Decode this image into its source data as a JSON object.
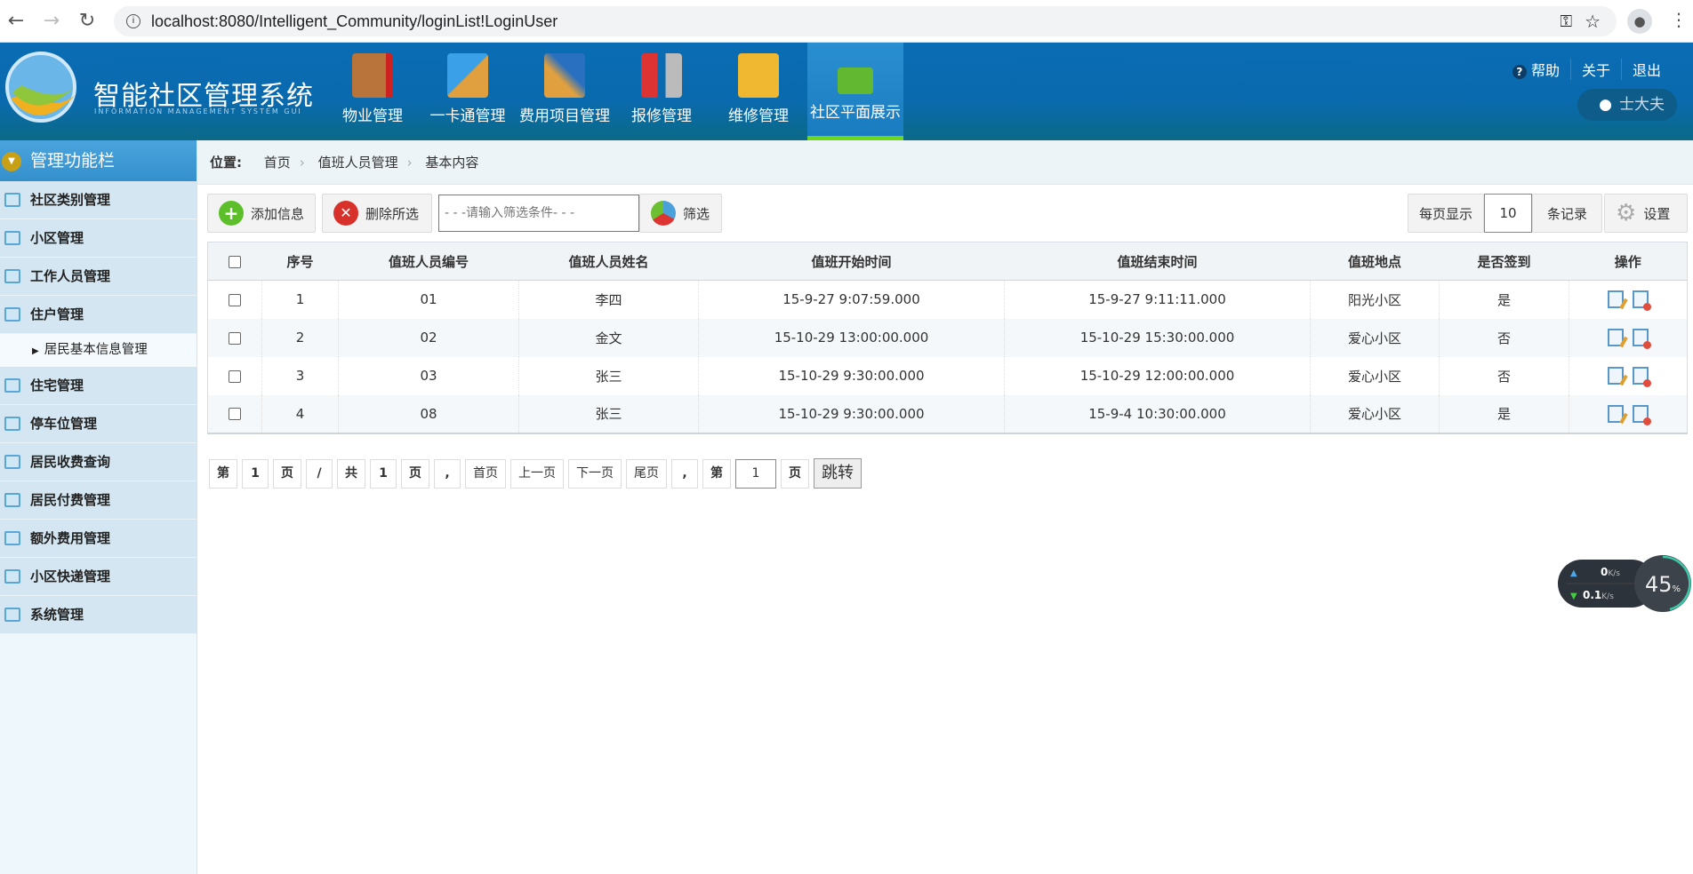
{
  "browser": {
    "url": "localhost:8080/Intelligent_Community/loginList!LoginUser"
  },
  "header": {
    "title": "智能社区管理系统",
    "subtitle": "INFORMATION MANAGEMENT SYSTEM GUI",
    "nav": [
      {
        "label": "物业管理"
      },
      {
        "label": "一卡通管理"
      },
      {
        "label": "费用项目管理"
      },
      {
        "label": "报修管理"
      },
      {
        "label": "维修管理"
      },
      {
        "label": "社区平面展示"
      }
    ],
    "links": {
      "help": "帮助",
      "about": "关于",
      "logout": "退出"
    },
    "user": "士大夫"
  },
  "sidebar": {
    "title": "管理功能栏",
    "items": [
      {
        "label": "社区类别管理"
      },
      {
        "label": "小区管理"
      },
      {
        "label": "工作人员管理"
      },
      {
        "label": "住户管理"
      }
    ],
    "sub": "居民基本信息管理",
    "items2": [
      {
        "label": "住宅管理"
      },
      {
        "label": "停车位管理"
      },
      {
        "label": "居民收费查询"
      },
      {
        "label": "居民付费管理"
      },
      {
        "label": "额外费用管理"
      },
      {
        "label": "小区快递管理"
      },
      {
        "label": "系统管理"
      }
    ]
  },
  "breadcrumb": {
    "label": "位置:",
    "items": [
      "首页",
      "值班人员管理",
      "基本内容"
    ]
  },
  "toolbar": {
    "add": "添加信息",
    "delete": "删除所选",
    "filter_placeholder": "- - -请输入筛选条件- - -",
    "filter": "筛选",
    "per_page_label": "每页显示",
    "per_page": "10",
    "records": "条记录",
    "settings": "设置"
  },
  "table": {
    "headers": [
      "序号",
      "值班人员编号",
      "值班人员姓名",
      "值班开始时间",
      "值班结束时间",
      "值班地点",
      "是否签到",
      "操作"
    ],
    "rows": [
      [
        "1",
        "01",
        "李四",
        "15-9-27 9:07:59.000",
        "15-9-27 9:11:11.000",
        "阳光小区",
        "是"
      ],
      [
        "2",
        "02",
        "金文",
        "15-10-29 13:00:00.000",
        "15-10-29 15:30:00.000",
        "爱心小区",
        "否"
      ],
      [
        "3",
        "03",
        "张三",
        "15-10-29 9:30:00.000",
        "15-10-29 12:00:00.000",
        "爱心小区",
        "否"
      ],
      [
        "4",
        "08",
        "张三",
        "15-10-29 9:30:00.000",
        "15-9-4 10:30:00.000",
        "爱心小区",
        "是"
      ]
    ]
  },
  "pager": {
    "parts": [
      "第",
      "1",
      "页",
      "/",
      "共",
      "1",
      "页",
      ",",
      "首页",
      "上一页",
      "下一页",
      "尾页",
      ",",
      "第"
    ],
    "input": "1",
    "page": "页",
    "go": "跳转"
  },
  "netmon": {
    "up": "0",
    "down": "0.1",
    "unit": "K/s",
    "percent": "45",
    "pct_sign": "%"
  }
}
